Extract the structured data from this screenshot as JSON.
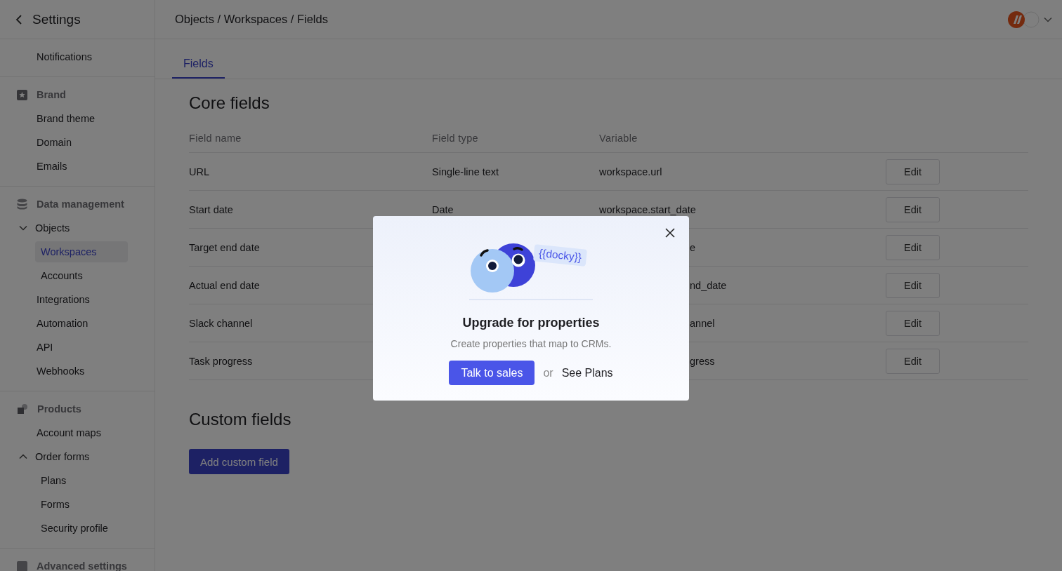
{
  "sidebar": {
    "title": "Settings",
    "sections": [
      {
        "items": [
          {
            "label": "Notifications",
            "selected": false
          }
        ]
      },
      {
        "title": "Brand",
        "items": [
          {
            "label": "Brand theme",
            "selected": false
          },
          {
            "label": "Domain",
            "selected": false
          },
          {
            "label": "Emails",
            "selected": false
          }
        ]
      },
      {
        "title": "Data management",
        "items": [
          {
            "label": "Objects",
            "selected": false,
            "expanded": true,
            "children": [
              {
                "label": "Workspaces",
                "selected": true
              },
              {
                "label": "Accounts",
                "selected": false
              }
            ]
          },
          {
            "label": "Integrations",
            "selected": false
          },
          {
            "label": "Automation",
            "selected": false
          },
          {
            "label": "API",
            "selected": false
          },
          {
            "label": "Webhooks",
            "selected": false
          }
        ]
      },
      {
        "title": "Products",
        "items": [
          {
            "label": "Account maps",
            "selected": false
          },
          {
            "label": "Order forms",
            "selected": false,
            "expanded": true,
            "children": [
              {
                "label": "Plans",
                "selected": false
              },
              {
                "label": "Forms",
                "selected": false
              },
              {
                "label": "Security profile",
                "selected": false
              }
            ]
          }
        ]
      },
      {
        "title": "Advanced settings"
      }
    ]
  },
  "breadcrumb": "Objects / Workspaces / Fields",
  "tabs": [
    {
      "label": "Fields",
      "selected": true
    }
  ],
  "core_fields": {
    "title": "Core fields",
    "columns": [
      "Field name",
      "Field type",
      "Variable"
    ],
    "rows": [
      {
        "name": "URL",
        "type": "Single-line text",
        "variable": "workspace.url",
        "covered": false,
        "action": "Edit"
      },
      {
        "name": "Start date",
        "type": "Date",
        "variable": "workspace.start_date",
        "covered": false,
        "action": "Edit"
      },
      {
        "name": "Target end date",
        "variable": "e",
        "covered": true,
        "action": "Edit"
      },
      {
        "name": "Actual end date",
        "variable": "nd_date",
        "covered": true,
        "action": "Edit"
      },
      {
        "name": "Slack channel",
        "variable": "annel",
        "covered": true,
        "action": "Edit"
      },
      {
        "name": "Task progress",
        "variable": "gress",
        "covered": true,
        "action": "Edit"
      }
    ]
  },
  "custom_fields": {
    "title": "Custom fields",
    "button": "Add custom field"
  },
  "modal": {
    "tag": "{{docky}}",
    "title": "Upgrade for properties",
    "text": "Create properties that map to CRMs.",
    "primary": "Talk to sales",
    "separator": "or",
    "link": "See Plans"
  }
}
